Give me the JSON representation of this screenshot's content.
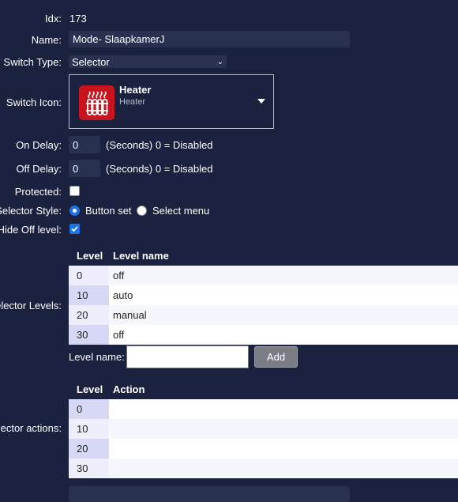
{
  "form": {
    "idx_label": "Idx:",
    "idx_value": "173",
    "name_label": "Name:",
    "name_value": "Mode- SlaapkamerJ",
    "switch_type_label": "Switch Type:",
    "switch_type_value": "Selector",
    "switch_icon_label": "Switch Icon:",
    "icon_title": "Heater",
    "icon_subtitle": "Heater",
    "on_delay_label": "On Delay:",
    "on_delay_value": "0",
    "on_delay_hint": "(Seconds) 0 = Disabled",
    "off_delay_label": "Off Delay:",
    "off_delay_value": "0",
    "off_delay_hint": "(Seconds) 0 = Disabled",
    "protected_label": "Protected:",
    "protected_checked": false,
    "selector_style_label": "Selector Style:",
    "style_option_1": "Button set",
    "style_option_2": "Select menu",
    "style_selected": "Button set",
    "hide_off_label": "Hide Off level:",
    "hide_off_checked": true,
    "selector_levels_label": "Selector Levels:",
    "selector_actions_label": "Selector actions:"
  },
  "levels_table": {
    "col_level": "Level",
    "col_name": "Level name",
    "rows": [
      {
        "level": "0",
        "name": "off"
      },
      {
        "level": "10",
        "name": "auto"
      },
      {
        "level": "20",
        "name": "manual"
      },
      {
        "level": "30",
        "name": "off"
      }
    ]
  },
  "add_level": {
    "label": "Level name:",
    "input_value": "",
    "button_label": "Add"
  },
  "actions_table": {
    "col_level": "Level",
    "col_action": "Action",
    "rows": [
      {
        "level": "0",
        "action": ""
      },
      {
        "level": "10",
        "action": ""
      },
      {
        "level": "20",
        "action": ""
      },
      {
        "level": "30",
        "action": ""
      }
    ]
  },
  "colors": {
    "background": "#1a2240",
    "field": "#283150",
    "heater_red": "#c8141c",
    "checkbox_blue": "#1a73e8"
  }
}
